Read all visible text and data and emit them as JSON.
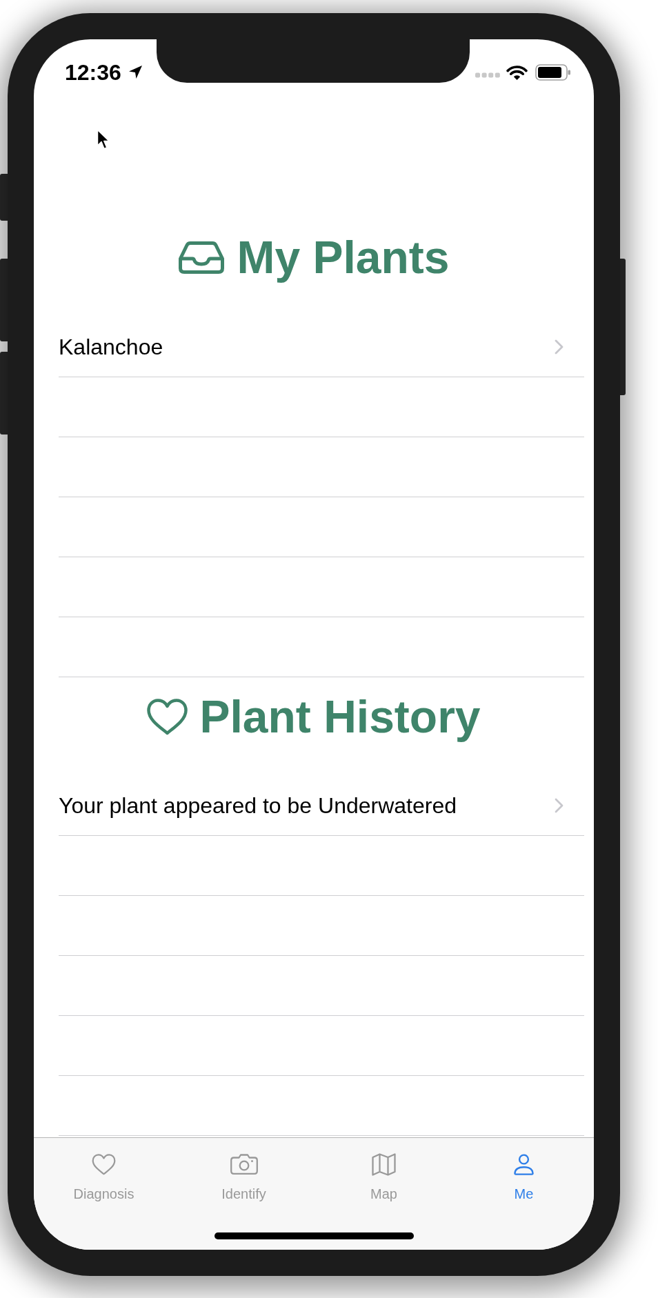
{
  "status_bar": {
    "time": "12:36"
  },
  "sections": [
    {
      "kind": "plants",
      "title": "My Plants",
      "rows": [
        {
          "label": "Kalanchoe"
        }
      ]
    },
    {
      "kind": "history",
      "title": "Plant History",
      "rows": [
        {
          "label": "Your plant appeared to be Underwatered"
        }
      ]
    }
  ],
  "tab_bar": {
    "tabs": [
      {
        "kind": "diagnosis",
        "label": "Diagnosis",
        "selected": false
      },
      {
        "kind": "identify",
        "label": "Identify",
        "selected": false
      },
      {
        "kind": "map",
        "label": "Map",
        "selected": false
      },
      {
        "kind": "profile",
        "label": "Me",
        "selected": true
      }
    ]
  }
}
